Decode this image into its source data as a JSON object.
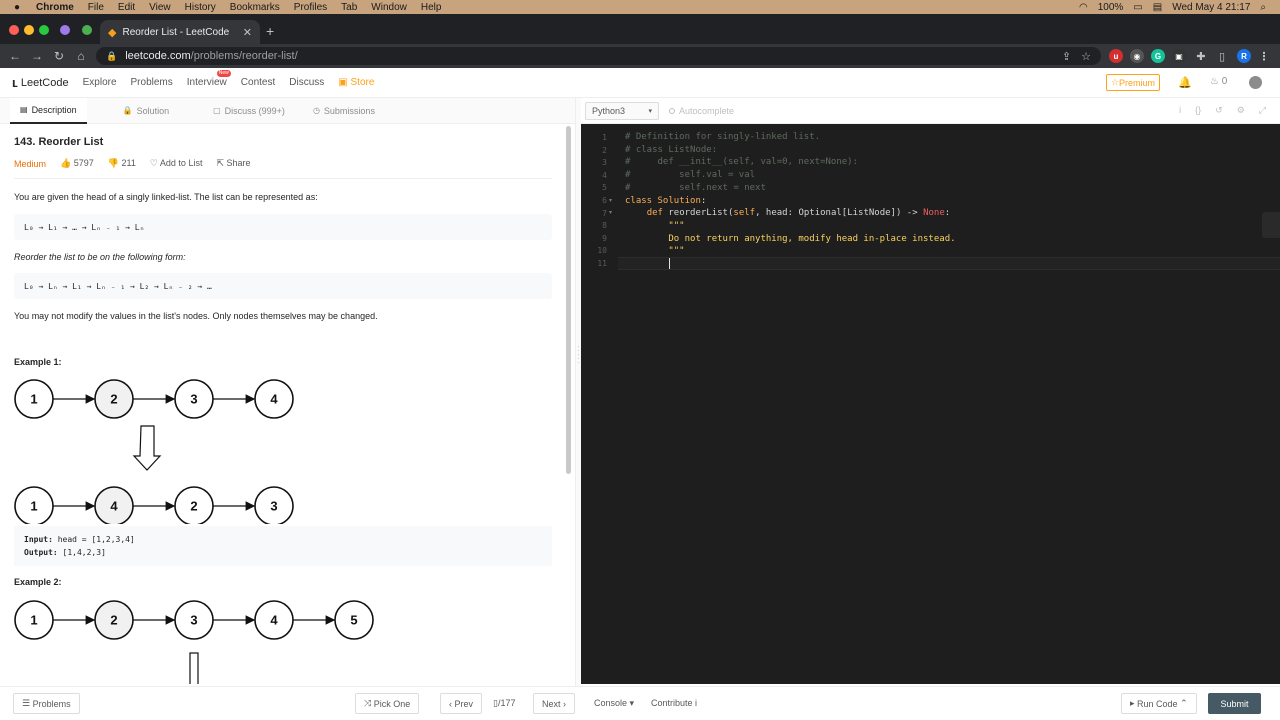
{
  "menubar": {
    "app": "Chrome",
    "items": [
      "File",
      "Edit",
      "View",
      "History",
      "Bookmarks",
      "Profiles",
      "Tab",
      "Window",
      "Help"
    ],
    "battery": "100%",
    "datetime": "Wed May 4  21:17"
  },
  "browser": {
    "tab_title": "Reorder List - LeetCode",
    "url_host": "leetcode.com",
    "url_path": "/problems/reorder-list/"
  },
  "nav": {
    "logo": "LeetCode",
    "links": [
      "Explore",
      "Problems",
      "Interview",
      "Contest",
      "Discuss",
      "Store"
    ],
    "new_badge": "New",
    "premium": "Premium",
    "streak": "0"
  },
  "tabs": {
    "description": "Description",
    "solution": "Solution",
    "discuss": "Discuss (999+)",
    "submissions": "Submissions"
  },
  "problem": {
    "title": "143. Reorder List",
    "difficulty": "Medium",
    "likes": "5797",
    "dislikes": "211",
    "add_to_list": "Add to List",
    "share": "Share",
    "intro": "You are given the head of a singly linked-list. The list can be represented as:",
    "form1": "L₀ → L₁ → … → Lₙ ₋ ₁ → Lₙ",
    "reorder_text": "Reorder the list to be on the following form:",
    "form2": "L₀ → Lₙ → L₁ → Lₙ ₋ ₁ → L₂ → Lₙ ₋ ₂ → …",
    "constraint": "You may not modify the values in the list's nodes. Only nodes themselves may be changed.",
    "example1_label": "Example 1:",
    "example1_before": [
      "1",
      "2",
      "3",
      "4"
    ],
    "example1_after": [
      "1",
      "4",
      "2",
      "3"
    ],
    "example1_input_label": "Input:",
    "example1_input": " head = [1,2,3,4]",
    "example1_output_label": "Output:",
    "example1_output": " [1,4,2,3]",
    "example2_label": "Example 2:",
    "example2_before": [
      "1",
      "2",
      "3",
      "4",
      "5"
    ]
  },
  "editor": {
    "language": "Python3",
    "autocomplete": "Autocomplete",
    "line_numbers": [
      "1",
      "2",
      "3",
      "4",
      "5",
      "6",
      "7",
      "8",
      "9",
      "10",
      "11"
    ]
  },
  "bottom": {
    "problems": "Problems",
    "pick_one": "Pick One",
    "prev": "Prev",
    "page": "/177",
    "next": "Next",
    "console": "Console",
    "contribute": "Contribute",
    "run_code": "Run Code",
    "submit": "Submit"
  },
  "colors": {
    "accent": "#ffa116",
    "medium": "#ef6c00",
    "submit_bg": "#455a64",
    "editor_bg": "#1e1e1e"
  }
}
